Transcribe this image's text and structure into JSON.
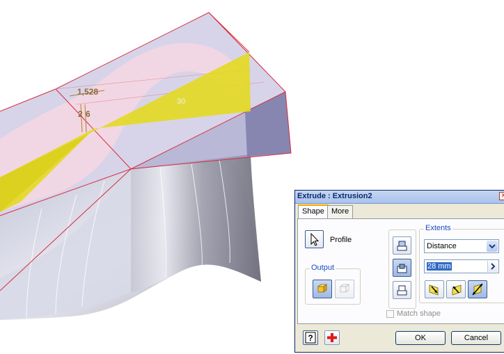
{
  "viewport": {
    "dimension_1": "1,528",
    "dimension_2": "2",
    "dimension_3": "6",
    "dimension_4": "30"
  },
  "dialog": {
    "title": "Extrude : Extrusion2",
    "close_label": "×",
    "tabs": [
      {
        "label": "Shape",
        "active": true
      },
      {
        "label": "More",
        "active": false
      }
    ],
    "profile_label": "Profile",
    "output": {
      "group_label": "Output",
      "options": [
        {
          "icon": "solid-icon",
          "selected": true
        },
        {
          "icon": "surface-icon",
          "selected": false
        }
      ]
    },
    "direction_buttons": [
      {
        "icon": "operation-join-icon",
        "selected": false
      },
      {
        "icon": "operation-cut-icon",
        "selected": true
      },
      {
        "icon": "operation-intersect-icon",
        "selected": false
      }
    ],
    "extents": {
      "group_label": "Extents",
      "selected": "Distance",
      "distance_value": "28 mm",
      "direction_buttons": [
        {
          "icon": "direction-1-icon",
          "selected": false
        },
        {
          "icon": "direction-2-icon",
          "selected": false
        },
        {
          "icon": "symmetric-icon",
          "selected": true
        }
      ]
    },
    "match_shape_label": "Match shape",
    "match_shape_checked": false,
    "ok_label": "OK",
    "cancel_label": "Cancel",
    "colors": {
      "accent": "#316ac5",
      "selection": "#f6a700",
      "profile_fill": "#e6dc2e"
    }
  }
}
